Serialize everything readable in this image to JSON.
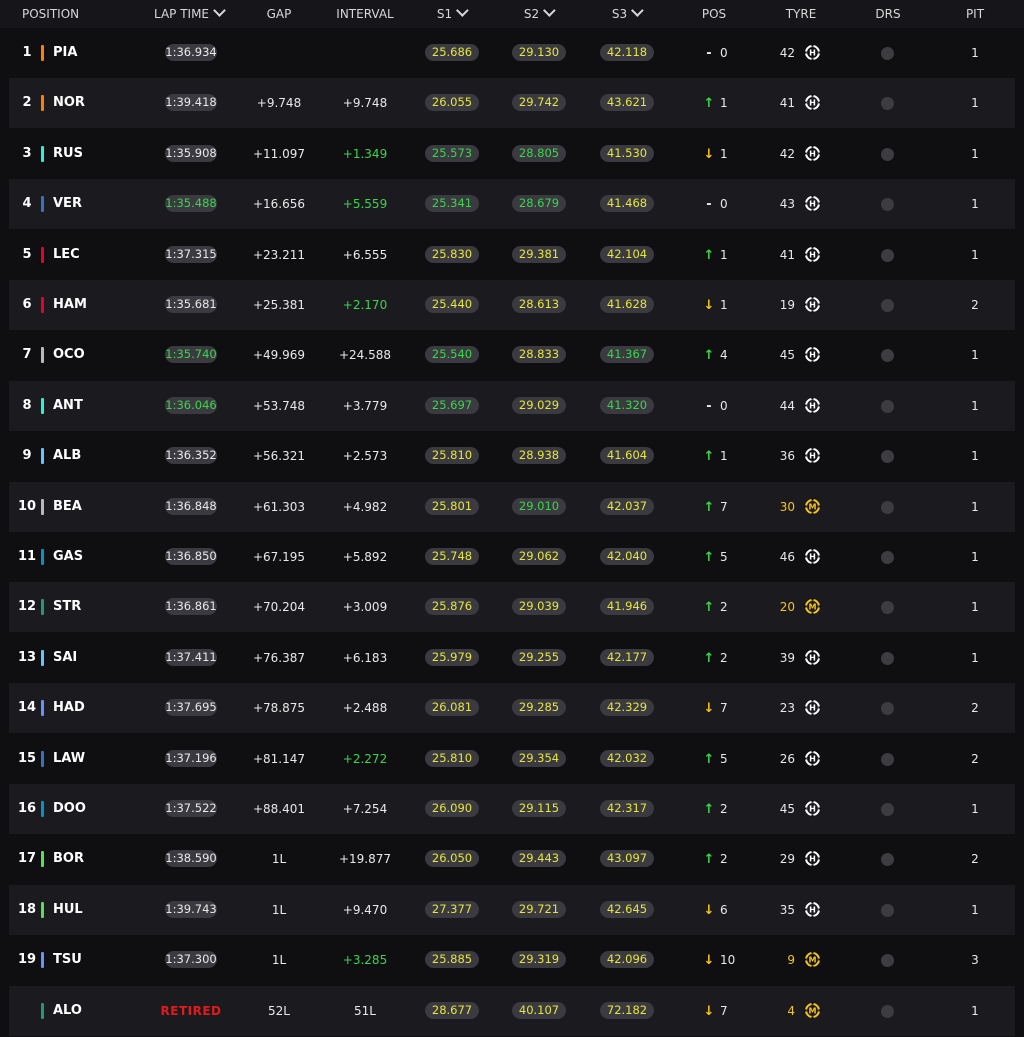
{
  "header": {
    "position": "POSITION",
    "lap_time": "LAP TIME",
    "gap": "GAP",
    "interval": "INTERVAL",
    "s1": "S1",
    "s2": "S2",
    "s3": "S3",
    "pos": "POS",
    "tyre": "TYRE",
    "drs": "DRS",
    "pit": "PIT"
  },
  "colors": {
    "yellow": "#e6e63b",
    "green": "#3ad64a",
    "white": "#e9e9e9",
    "red": "#e31a1a",
    "tyre_medium": "#f5c518",
    "tyre_hard": "#ffffff"
  },
  "rows": [
    {
      "num": "1",
      "code": "PIA",
      "team_color": "#ff8000",
      "lap": "1:36.934",
      "lap_c": "white",
      "gap": "",
      "interval": "",
      "int_c": "white",
      "s1": "25.686",
      "s1_c": "yellow",
      "s2": "29.130",
      "s2_c": "yellow",
      "s3": "42.118",
      "s3_c": "yellow",
      "pos_dir": "same",
      "pos_arrow": "-",
      "pos_val": "0",
      "tyre_age": "42",
      "tyre_compound": "H",
      "pit": "1"
    },
    {
      "num": "2",
      "code": "NOR",
      "team_color": "#ff8000",
      "lap": "1:39.418",
      "lap_c": "white",
      "gap": "+9.748",
      "interval": "+9.748",
      "int_c": "white",
      "s1": "26.055",
      "s1_c": "yellow",
      "s2": "29.742",
      "s2_c": "yellow",
      "s3": "43.621",
      "s3_c": "yellow",
      "pos_dir": "up",
      "pos_arrow": "↑",
      "pos_val": "1",
      "tyre_age": "41",
      "tyre_compound": "H",
      "pit": "1"
    },
    {
      "num": "3",
      "code": "RUS",
      "team_color": "#27f4d2",
      "lap": "1:35.908",
      "lap_c": "white",
      "gap": "+11.097",
      "interval": "+1.349",
      "int_c": "green",
      "s1": "25.573",
      "s1_c": "green",
      "s2": "28.805",
      "s2_c": "green",
      "s3": "41.530",
      "s3_c": "yellow",
      "pos_dir": "down",
      "pos_arrow": "↓",
      "pos_val": "1",
      "tyre_age": "42",
      "tyre_compound": "H",
      "pit": "1"
    },
    {
      "num": "4",
      "code": "VER",
      "team_color": "#3671c6",
      "lap": "1:35.488",
      "lap_c": "green",
      "gap": "+16.656",
      "interval": "+5.559",
      "int_c": "green",
      "s1": "25.341",
      "s1_c": "green",
      "s2": "28.679",
      "s2_c": "green",
      "s3": "41.468",
      "s3_c": "yellow",
      "pos_dir": "same",
      "pos_arrow": "-",
      "pos_val": "0",
      "tyre_age": "43",
      "tyre_compound": "H",
      "pit": "1"
    },
    {
      "num": "5",
      "code": "LEC",
      "team_color": "#e8002d",
      "lap": "1:37.315",
      "lap_c": "white",
      "gap": "+23.211",
      "interval": "+6.555",
      "int_c": "white",
      "s1": "25.830",
      "s1_c": "yellow",
      "s2": "29.381",
      "s2_c": "yellow",
      "s3": "42.104",
      "s3_c": "yellow",
      "pos_dir": "up",
      "pos_arrow": "↑",
      "pos_val": "1",
      "tyre_age": "41",
      "tyre_compound": "H",
      "pit": "1"
    },
    {
      "num": "6",
      "code": "HAM",
      "team_color": "#e8002d",
      "lap": "1:35.681",
      "lap_c": "white",
      "gap": "+25.381",
      "interval": "+2.170",
      "int_c": "green",
      "s1": "25.440",
      "s1_c": "yellow",
      "s2": "28.613",
      "s2_c": "yellow",
      "s3": "41.628",
      "s3_c": "yellow",
      "pos_dir": "down",
      "pos_arrow": "↓",
      "pos_val": "1",
      "tyre_age": "19",
      "tyre_compound": "H",
      "pit": "2"
    },
    {
      "num": "7",
      "code": "OCO",
      "team_color": "#b6babd",
      "lap": "1:35.740",
      "lap_c": "green",
      "gap": "+49.969",
      "interval": "+24.588",
      "int_c": "white",
      "s1": "25.540",
      "s1_c": "green",
      "s2": "28.833",
      "s2_c": "yellow",
      "s3": "41.367",
      "s3_c": "green",
      "pos_dir": "up",
      "pos_arrow": "↑",
      "pos_val": "4",
      "tyre_age": "45",
      "tyre_compound": "H",
      "pit": "1"
    },
    {
      "num": "8",
      "code": "ANT",
      "team_color": "#27f4d2",
      "lap": "1:36.046",
      "lap_c": "green",
      "gap": "+53.748",
      "interval": "+3.779",
      "int_c": "white",
      "s1": "25.697",
      "s1_c": "green",
      "s2": "29.029",
      "s2_c": "yellow",
      "s3": "41.320",
      "s3_c": "green",
      "pos_dir": "same",
      "pos_arrow": "-",
      "pos_val": "0",
      "tyre_age": "44",
      "tyre_compound": "H",
      "pit": "1"
    },
    {
      "num": "9",
      "code": "ALB",
      "team_color": "#64c4ff",
      "lap": "1:36.352",
      "lap_c": "white",
      "gap": "+56.321",
      "interval": "+2.573",
      "int_c": "white",
      "s1": "25.810",
      "s1_c": "yellow",
      "s2": "28.938",
      "s2_c": "yellow",
      "s3": "41.604",
      "s3_c": "yellow",
      "pos_dir": "up",
      "pos_arrow": "↑",
      "pos_val": "1",
      "tyre_age": "36",
      "tyre_compound": "H",
      "pit": "1"
    },
    {
      "num": "10",
      "code": "BEA",
      "team_color": "#b6babd",
      "lap": "1:36.848",
      "lap_c": "white",
      "gap": "+61.303",
      "interval": "+4.982",
      "int_c": "white",
      "s1": "25.801",
      "s1_c": "yellow",
      "s2": "29.010",
      "s2_c": "green",
      "s3": "42.037",
      "s3_c": "yellow",
      "pos_dir": "up",
      "pos_arrow": "↑",
      "pos_val": "7",
      "tyre_age": "30",
      "tyre_compound": "M",
      "pit": "1"
    },
    {
      "num": "11",
      "code": "GAS",
      "team_color": "#0093cc",
      "lap": "1:36.850",
      "lap_c": "white",
      "gap": "+67.195",
      "interval": "+5.892",
      "int_c": "white",
      "s1": "25.748",
      "s1_c": "yellow",
      "s2": "29.062",
      "s2_c": "yellow",
      "s3": "42.040",
      "s3_c": "yellow",
      "pos_dir": "up",
      "pos_arrow": "↑",
      "pos_val": "5",
      "tyre_age": "46",
      "tyre_compound": "H",
      "pit": "1"
    },
    {
      "num": "12",
      "code": "STR",
      "team_color": "#229971",
      "lap": "1:36.861",
      "lap_c": "white",
      "gap": "+70.204",
      "interval": "+3.009",
      "int_c": "white",
      "s1": "25.876",
      "s1_c": "yellow",
      "s2": "29.039",
      "s2_c": "yellow",
      "s3": "41.946",
      "s3_c": "yellow",
      "pos_dir": "up",
      "pos_arrow": "↑",
      "pos_val": "2",
      "tyre_age": "20",
      "tyre_compound": "M",
      "pit": "1"
    },
    {
      "num": "13",
      "code": "SAI",
      "team_color": "#64c4ff",
      "lap": "1:37.411",
      "lap_c": "white",
      "gap": "+76.387",
      "interval": "+6.183",
      "int_c": "white",
      "s1": "25.979",
      "s1_c": "yellow",
      "s2": "29.255",
      "s2_c": "yellow",
      "s3": "42.177",
      "s3_c": "yellow",
      "pos_dir": "up",
      "pos_arrow": "↑",
      "pos_val": "2",
      "tyre_age": "39",
      "tyre_compound": "H",
      "pit": "1"
    },
    {
      "num": "14",
      "code": "HAD",
      "team_color": "#6692ff",
      "lap": "1:37.695",
      "lap_c": "white",
      "gap": "+78.875",
      "interval": "+2.488",
      "int_c": "white",
      "s1": "26.081",
      "s1_c": "yellow",
      "s2": "29.285",
      "s2_c": "yellow",
      "s3": "42.329",
      "s3_c": "yellow",
      "pos_dir": "down",
      "pos_arrow": "↓",
      "pos_val": "7",
      "tyre_age": "23",
      "tyre_compound": "H",
      "pit": "2"
    },
    {
      "num": "15",
      "code": "LAW",
      "team_color": "#3671c6",
      "lap": "1:37.196",
      "lap_c": "white",
      "gap": "+81.147",
      "interval": "+2.272",
      "int_c": "green",
      "s1": "25.810",
      "s1_c": "yellow",
      "s2": "29.354",
      "s2_c": "yellow",
      "s3": "42.032",
      "s3_c": "yellow",
      "pos_dir": "up",
      "pos_arrow": "↑",
      "pos_val": "5",
      "tyre_age": "26",
      "tyre_compound": "H",
      "pit": "2"
    },
    {
      "num": "16",
      "code": "DOO",
      "team_color": "#0093cc",
      "lap": "1:37.522",
      "lap_c": "white",
      "gap": "+88.401",
      "interval": "+7.254",
      "int_c": "white",
      "s1": "26.090",
      "s1_c": "yellow",
      "s2": "29.115",
      "s2_c": "yellow",
      "s3": "42.317",
      "s3_c": "yellow",
      "pos_dir": "up",
      "pos_arrow": "↑",
      "pos_val": "2",
      "tyre_age": "45",
      "tyre_compound": "H",
      "pit": "1"
    },
    {
      "num": "17",
      "code": "BOR",
      "team_color": "#52e252",
      "lap": "1:38.590",
      "lap_c": "white",
      "gap": "1L",
      "interval": "+19.877",
      "int_c": "white",
      "s1": "26.050",
      "s1_c": "yellow",
      "s2": "29.443",
      "s2_c": "yellow",
      "s3": "43.097",
      "s3_c": "yellow",
      "pos_dir": "up",
      "pos_arrow": "↑",
      "pos_val": "2",
      "tyre_age": "29",
      "tyre_compound": "H",
      "pit": "2"
    },
    {
      "num": "18",
      "code": "HUL",
      "team_color": "#52e252",
      "lap": "1:39.743",
      "lap_c": "white",
      "gap": "1L",
      "interval": "+9.470",
      "int_c": "white",
      "s1": "27.377",
      "s1_c": "yellow",
      "s2": "29.721",
      "s2_c": "yellow",
      "s3": "42.645",
      "s3_c": "yellow",
      "pos_dir": "down",
      "pos_arrow": "↓",
      "pos_val": "6",
      "tyre_age": "35",
      "tyre_compound": "H",
      "pit": "1"
    },
    {
      "num": "19",
      "code": "TSU",
      "team_color": "#6692ff",
      "lap": "1:37.300",
      "lap_c": "white",
      "gap": "1L",
      "interval": "+3.285",
      "int_c": "green",
      "s1": "25.885",
      "s1_c": "yellow",
      "s2": "29.319",
      "s2_c": "yellow",
      "s3": "42.096",
      "s3_c": "yellow",
      "pos_dir": "down",
      "pos_arrow": "↓",
      "pos_val": "10",
      "tyre_age": "9",
      "tyre_compound": "M",
      "pit": "3"
    },
    {
      "num": "",
      "code": "ALO",
      "team_color": "#229971",
      "lap": "RETIRED",
      "lap_c": "retired",
      "gap": "52L",
      "interval": "51L",
      "int_c": "white",
      "s1": "28.677",
      "s1_c": "yellow",
      "s2": "40.107",
      "s2_c": "yellow",
      "s3": "72.182",
      "s3_c": "yellow",
      "pos_dir": "down",
      "pos_arrow": "↓",
      "pos_val": "7",
      "tyre_age": "4",
      "tyre_compound": "M",
      "pit": "1"
    }
  ]
}
